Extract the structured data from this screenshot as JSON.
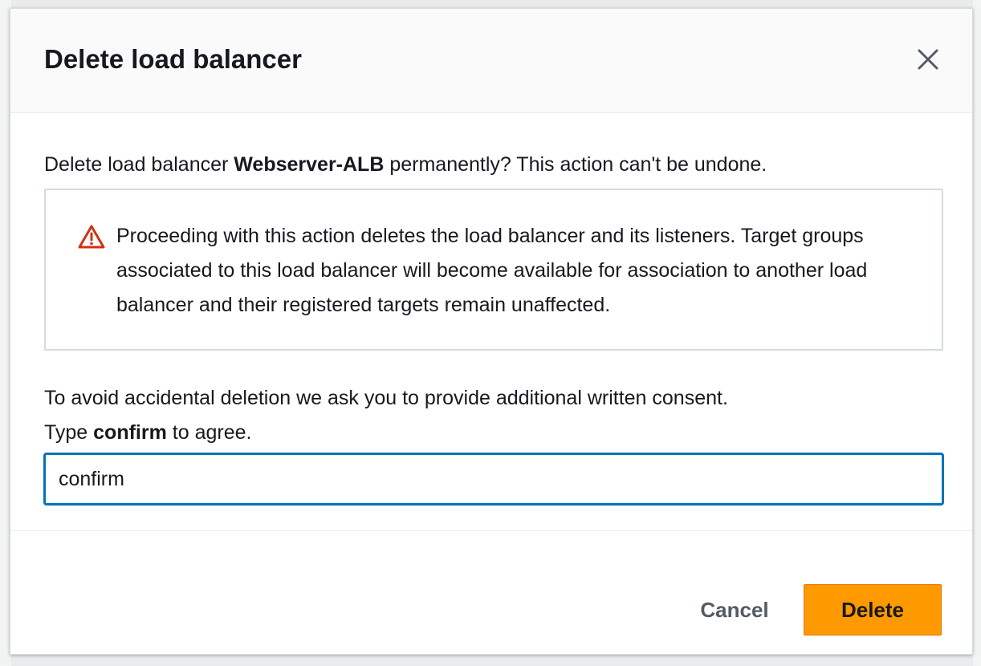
{
  "dialog": {
    "title": "Delete load balancer",
    "lead_prefix": "Delete load balancer ",
    "lead_name": "Webserver-ALB",
    "lead_suffix": " permanently? This action can't be undone.",
    "warning_text": "Proceeding with this action deletes the load balancer and its listeners. Target groups associated to this load balancer will become available for association to another load balancer and their registered targets remain unaffected.",
    "consent_line1": "To avoid accidental deletion we ask you to provide additional written consent.",
    "consent_type_prefix": "Type ",
    "consent_keyword": "confirm",
    "consent_type_suffix": " to agree.",
    "input_value": "confirm",
    "cancel_label": "Cancel",
    "delete_label": "Delete"
  },
  "icons": {
    "close": "close-icon",
    "warning": "warning-icon"
  },
  "colors": {
    "accent": "#0073bb",
    "primary_button": "#ff9900",
    "warning": "#d13212"
  }
}
